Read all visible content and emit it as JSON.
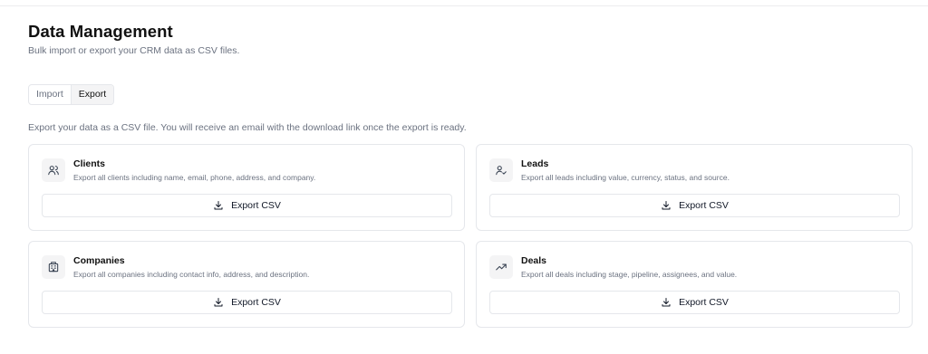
{
  "header": {
    "title": "Data Management",
    "subtitle": "Bulk import or export your CRM data as CSV files."
  },
  "tabs": [
    {
      "label": "Import",
      "active": false
    },
    {
      "label": "Export",
      "active": true
    }
  ],
  "export": {
    "description": "Export your data as a CSV file. You will receive an email with the download link once the export is ready.",
    "button_label": "Export CSV",
    "cards": [
      {
        "name": "Clients",
        "description": "Export all clients including name, email, phone, address, and company.",
        "icon": "users-icon"
      },
      {
        "name": "Leads",
        "description": "Export all leads including value, currency, status, and source.",
        "icon": "user-check-icon"
      },
      {
        "name": "Companies",
        "description": "Export all companies including contact info, address, and description.",
        "icon": "building-icon"
      },
      {
        "name": "Deals",
        "description": "Export all deals including stage, pipeline, assignees, and value.",
        "icon": "trending-up-icon"
      }
    ]
  },
  "colors": {
    "text_primary": "#111111",
    "text_muted": "#6b7280",
    "border": "#e5e7eb",
    "tab_active_bg": "#f4f4f5"
  }
}
